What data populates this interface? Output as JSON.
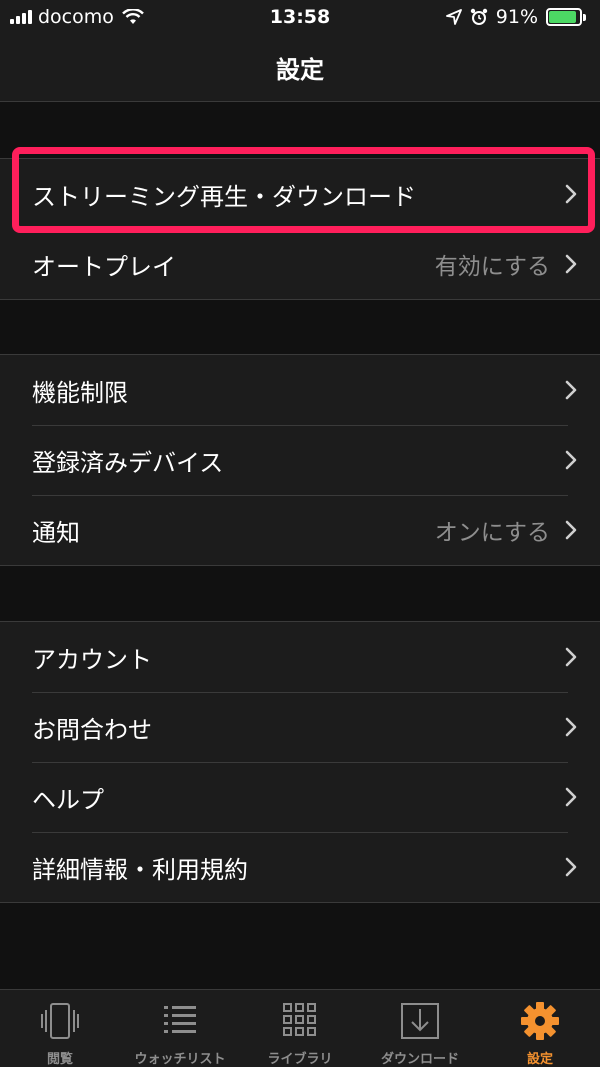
{
  "status_bar": {
    "carrier": "docomo",
    "time": "13:58",
    "battery_percent": "91%",
    "battery_level": 0.91,
    "battery_color": "#4cd964",
    "icons": [
      "signal-icon",
      "wifi-icon",
      "location-icon",
      "alarm-icon",
      "battery-icon"
    ]
  },
  "nav": {
    "title": "設定"
  },
  "groups": [
    {
      "items": [
        {
          "label": "ストリーミング再生・ダウンロード",
          "value": "",
          "highlighted": true
        },
        {
          "label": "オートプレイ",
          "value": "有効にする"
        }
      ]
    },
    {
      "items": [
        {
          "label": "機能制限",
          "value": ""
        },
        {
          "label": "登録済みデバイス",
          "value": ""
        },
        {
          "label": "通知",
          "value": "オンにする"
        }
      ]
    },
    {
      "items": [
        {
          "label": "アカウント",
          "value": ""
        },
        {
          "label": "お問合わせ",
          "value": ""
        },
        {
          "label": "ヘルプ",
          "value": ""
        },
        {
          "label": "詳細情報・利用規約",
          "value": ""
        }
      ]
    }
  ],
  "highlight_color": "#ff1f5b",
  "tabs": [
    {
      "label": "閲覧",
      "icon": "browse-icon",
      "active": false
    },
    {
      "label": "ウォッチリスト",
      "icon": "watchlist-icon",
      "active": false
    },
    {
      "label": "ライブラリ",
      "icon": "library-icon",
      "active": false
    },
    {
      "label": "ダウンロード",
      "icon": "download-icon",
      "active": false
    },
    {
      "label": "設定",
      "icon": "gear-icon",
      "active": true
    }
  ],
  "active_tab_color": "#f5922f"
}
